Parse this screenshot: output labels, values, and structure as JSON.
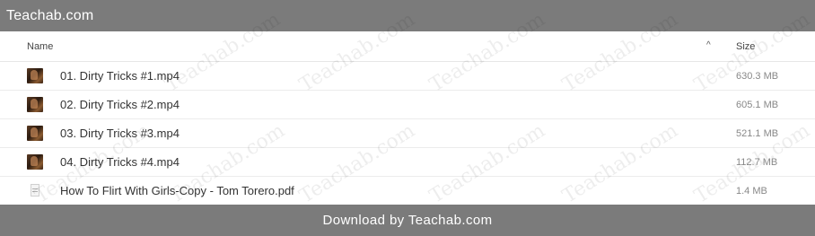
{
  "header": {
    "title": "Teachab.com"
  },
  "columns": {
    "name": "Name",
    "sort_indicator": "^",
    "size": "Size"
  },
  "files": [
    {
      "name": "01. Dirty Tricks #1.mp4",
      "size": "630.3 MB",
      "icon": "video-thumbnail"
    },
    {
      "name": "02. Dirty Tricks #2.mp4",
      "size": "605.1 MB",
      "icon": "video-thumbnail"
    },
    {
      "name": "03. Dirty Tricks #3.mp4",
      "size": "521.1 MB",
      "icon": "video-thumbnail"
    },
    {
      "name": "04. Dirty Tricks #4.mp4",
      "size": "112.7 MB",
      "icon": "video-thumbnail"
    },
    {
      "name": "How To Flirt With Girls-Copy - Tom Torero.pdf",
      "size": "1.4 MB",
      "icon": "pdf-thumbnail"
    }
  ],
  "footer": {
    "download_label": "Download by Teachab.com"
  },
  "watermark": {
    "text": "Teachab.com"
  },
  "colors": {
    "bar_background": "#7b7b7b",
    "bar_text": "#ffffff"
  }
}
